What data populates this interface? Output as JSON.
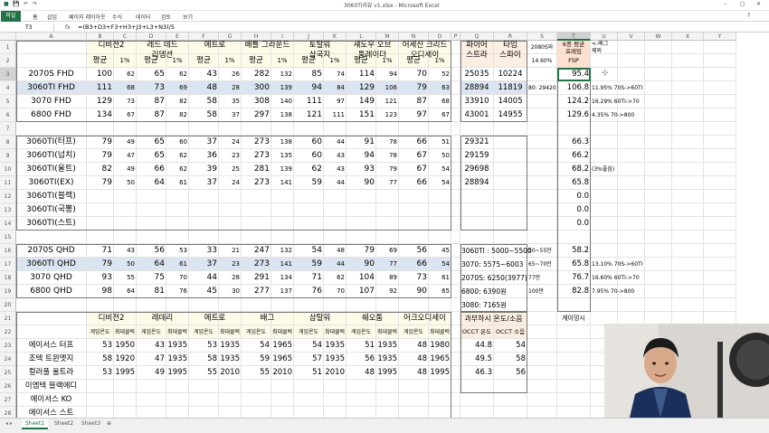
{
  "window": {
    "title": "3060Ti리뷰 v1.xlsx  -  Microsoft Excel"
  },
  "ribbon": {
    "file_tab": "파일",
    "tabs": [
      "홈",
      "삽입",
      "페이지 레이아웃",
      "수식",
      "데이터",
      "검토",
      "보기"
    ]
  },
  "formula_bar": {
    "name_box": "T3",
    "fx": "fx",
    "formula": "=(B3+D3+F3+H3+J3+L3+N3)/5"
  },
  "columns": [
    "A",
    "B",
    "C",
    "D",
    "E",
    "F",
    "G",
    "H",
    "I",
    "J",
    "K",
    "L",
    "M",
    "N",
    "O",
    "P",
    "Q",
    "R",
    "S",
    "T",
    "U",
    "V",
    "W",
    "X",
    "Y"
  ],
  "rows": [
    "1",
    "2",
    "3",
    "4",
    "5",
    "6",
    "7",
    "8",
    "9",
    "10",
    "11",
    "12",
    "13",
    "14",
    "15",
    "16",
    "17",
    "18",
    "19",
    "20",
    "21",
    "22",
    "23",
    "24",
    "25",
    "26",
    "27",
    "28"
  ],
  "games": {
    "b": "디비전2",
    "d": "레드 데드\n리뎀션",
    "f": "메트로",
    "h": "배틀 그라운드",
    "j": "토탈워\n삼국지",
    "l": "섀도우 오브\n툼레이더",
    "n": "어세신 크리드\n오디세이",
    "q": "파이어\n스트라",
    "r": "타임\n스파이"
  },
  "s_header": "2080S와",
  "s_sub": "14.60%",
  "t_header": "6종 평균\n프레임",
  "t_sub": "FSP",
  "u_header": "<-베그\n제외",
  "avg_label": "평균",
  "pct_label": "1%",
  "top_table": [
    {
      "name": "2070S FHD",
      "v": [
        "100",
        "62",
        "65",
        "62",
        "43",
        "26",
        "282",
        "132",
        "85",
        "74",
        "114",
        "94",
        "70",
        "52"
      ],
      "q": "25035",
      "r": "10224",
      "s": "",
      "t": "95.4",
      "u": ""
    },
    {
      "name": "3060TI FHD",
      "v": [
        "111",
        "68",
        "73",
        "69",
        "48",
        "28",
        "300",
        "139",
        "94",
        "84",
        "129",
        "106",
        "79",
        "63"
      ],
      "q": "28894",
      "r": "11819",
      "s": "80: 29420",
      "t": "106.8",
      "u": "11.95% 70S->60TI"
    },
    {
      "name": "3070 FHD",
      "v": [
        "129",
        "73",
        "87",
        "82",
        "58",
        "35",
        "308",
        "140",
        "111",
        "97",
        "149",
        "121",
        "87",
        "68"
      ],
      "q": "33910",
      "r": "14005",
      "s": "",
      "t": "124.2",
      "u": "16.29% 60TI->70"
    },
    {
      "name": "6800 FHD",
      "v": [
        "134",
        "67",
        "87",
        "82",
        "58",
        "37",
        "297",
        "138",
        "121",
        "111",
        "151",
        "123",
        "97",
        "67"
      ],
      "q": "43001",
      "r": "14955",
      "s": "",
      "t": "129.6",
      "u": "4.35% 70->800"
    }
  ],
  "mid_table": [
    {
      "name": "3060TI(터프)",
      "v": [
        "79",
        "49",
        "65",
        "60",
        "37",
        "24",
        "273",
        "138",
        "60",
        "44",
        "91",
        "78",
        "66",
        "51"
      ],
      "q": "29321",
      "t": "66.3",
      "u": ""
    },
    {
      "name": "3060TI(넙치)",
      "v": [
        "79",
        "47",
        "65",
        "62",
        "36",
        "23",
        "273",
        "135",
        "60",
        "43",
        "94",
        "78",
        "67",
        "50"
      ],
      "q": "29159",
      "t": "66.2",
      "u": ""
    },
    {
      "name": "3060TI(울트)",
      "v": [
        "82",
        "49",
        "66",
        "62",
        "39",
        "25",
        "281",
        "139",
        "62",
        "43",
        "93",
        "79",
        "67",
        "54"
      ],
      "q": "29698",
      "t": "68.2",
      "u": "(3%좋음)"
    },
    {
      "name": "3060TI(EX)",
      "v": [
        "79",
        "50",
        "64",
        "61",
        "37",
        "24",
        "273",
        "141",
        "59",
        "44",
        "90",
        "77",
        "66",
        "54"
      ],
      "q": "28894",
      "t": "65.8",
      "u": ""
    },
    {
      "name": "3060TI(블랙)",
      "v": [
        "",
        "",
        "",
        "",
        "",
        "",
        "",
        "",
        "",
        "",
        "",
        "",
        "",
        ""
      ],
      "q": "",
      "t": "0.0",
      "u": ""
    },
    {
      "name": "3060TI(국뽕)",
      "v": [
        "",
        "",
        "",
        "",
        "",
        "",
        "",
        "",
        "",
        "",
        "",
        "",
        "",
        ""
      ],
      "q": "",
      "t": "0.0",
      "u": ""
    },
    {
      "name": "3060TI(스트)",
      "v": [
        "",
        "",
        "",
        "",
        "",
        "",
        "",
        "",
        "",
        "",
        "",
        "",
        "",
        ""
      ],
      "q": "",
      "t": "0.0",
      "u": ""
    }
  ],
  "qhd_table": [
    {
      "name": "2070S QHD",
      "v": [
        "71",
        "43",
        "56",
        "53",
        "33",
        "21",
        "247",
        "132",
        "54",
        "48",
        "79",
        "69",
        "56",
        "45"
      ],
      "q": "3060TI : 5000~5500",
      "s": "50~55만",
      "t": "58.2",
      "u": ""
    },
    {
      "name": "3060TI QHD",
      "v": [
        "79",
        "50",
        "64",
        "61",
        "37",
        "23",
        "273",
        "141",
        "59",
        "44",
        "90",
        "77",
        "66",
        "54"
      ],
      "q": "3070:  5575~6003",
      "s": "65~70만",
      "t": "65.8",
      "u": "13.10% 70S->60TI"
    },
    {
      "name": "3070 QHD",
      "v": [
        "93",
        "55",
        "75",
        "70",
        "44",
        "28",
        "291",
        "134",
        "71",
        "62",
        "104",
        "89",
        "73",
        "61"
      ],
      "q": "2070S:  6250(3977)",
      "s": "77만",
      "t": "76.7",
      "u": "16.60% 60TI->70"
    },
    {
      "name": "6800 QHD",
      "v": [
        "98",
        "64",
        "81",
        "76",
        "45",
        "30",
        "277",
        "137",
        "76",
        "70",
        "107",
        "92",
        "90",
        "65"
      ],
      "q": "6800:  6390원",
      "s": "100만",
      "t": "82.8",
      "u": "7.95% 70->800"
    }
  ],
  "q_extra": "3080:  7165원",
  "bottom": {
    "game_headers": [
      "디비전2",
      "레데리",
      "메트로",
      "배그",
      "삼탈워",
      "쉐오툼",
      "어크오디세이"
    ],
    "temp_label": "게임온도",
    "clock_label": "최대클럭",
    "oc_header": "과부하시 온도/소음",
    "occt_temp": "OCCT 온도",
    "occt_noise": "OCCT 소음",
    "t_header": "게이밍시",
    "rows": [
      {
        "name": "에이서스 터프",
        "v": [
          "53",
          "1950",
          "43",
          "1935",
          "53",
          "1935",
          "54",
          "1965",
          "54",
          "1935",
          "51",
          "1935",
          "48",
          "1980"
        ],
        "q": "44.8",
        "r": "54"
      },
      {
        "name": "조텍 트윈엣지",
        "v": [
          "58",
          "1920",
          "47",
          "1935",
          "58",
          "1935",
          "59",
          "1965",
          "57",
          "1935",
          "56",
          "1935",
          "48",
          "1965"
        ],
        "q": "49.5",
        "r": "58"
      },
      {
        "name": "컬러풀 울트라",
        "v": [
          "53",
          "1995",
          "49",
          "1995",
          "55",
          "2010",
          "55",
          "2010",
          "51",
          "2010",
          "48",
          "1995",
          "48",
          "1995"
        ],
        "q": "46.3",
        "r": "56"
      },
      {
        "name": "이엠텍 블랙에디",
        "v": [
          "",
          "",
          "",
          "",
          "",
          "",
          "",
          "",
          "",
          "",
          "",
          "",
          "",
          ""
        ],
        "q": "",
        "r": ""
      },
      {
        "name": "에이서스 KO",
        "v": [
          "",
          "",
          "",
          "",
          "",
          "",
          "",
          "",
          "",
          "",
          "",
          "",
          "",
          ""
        ],
        "q": "",
        "r": ""
      },
      {
        "name": "에이서스 스트",
        "v": [
          "",
          "",
          "",
          "",
          "",
          "",
          "",
          "",
          "",
          "",
          "",
          "",
          "",
          ""
        ],
        "q": "",
        "r": ""
      }
    ]
  },
  "sheets": [
    "Sheet1",
    "Sheet2",
    "Sheet3"
  ],
  "colors": {
    "excel_green": "#217346",
    "blue_row": "#dbe5f1",
    "orange_cell": "#fde9d9"
  }
}
